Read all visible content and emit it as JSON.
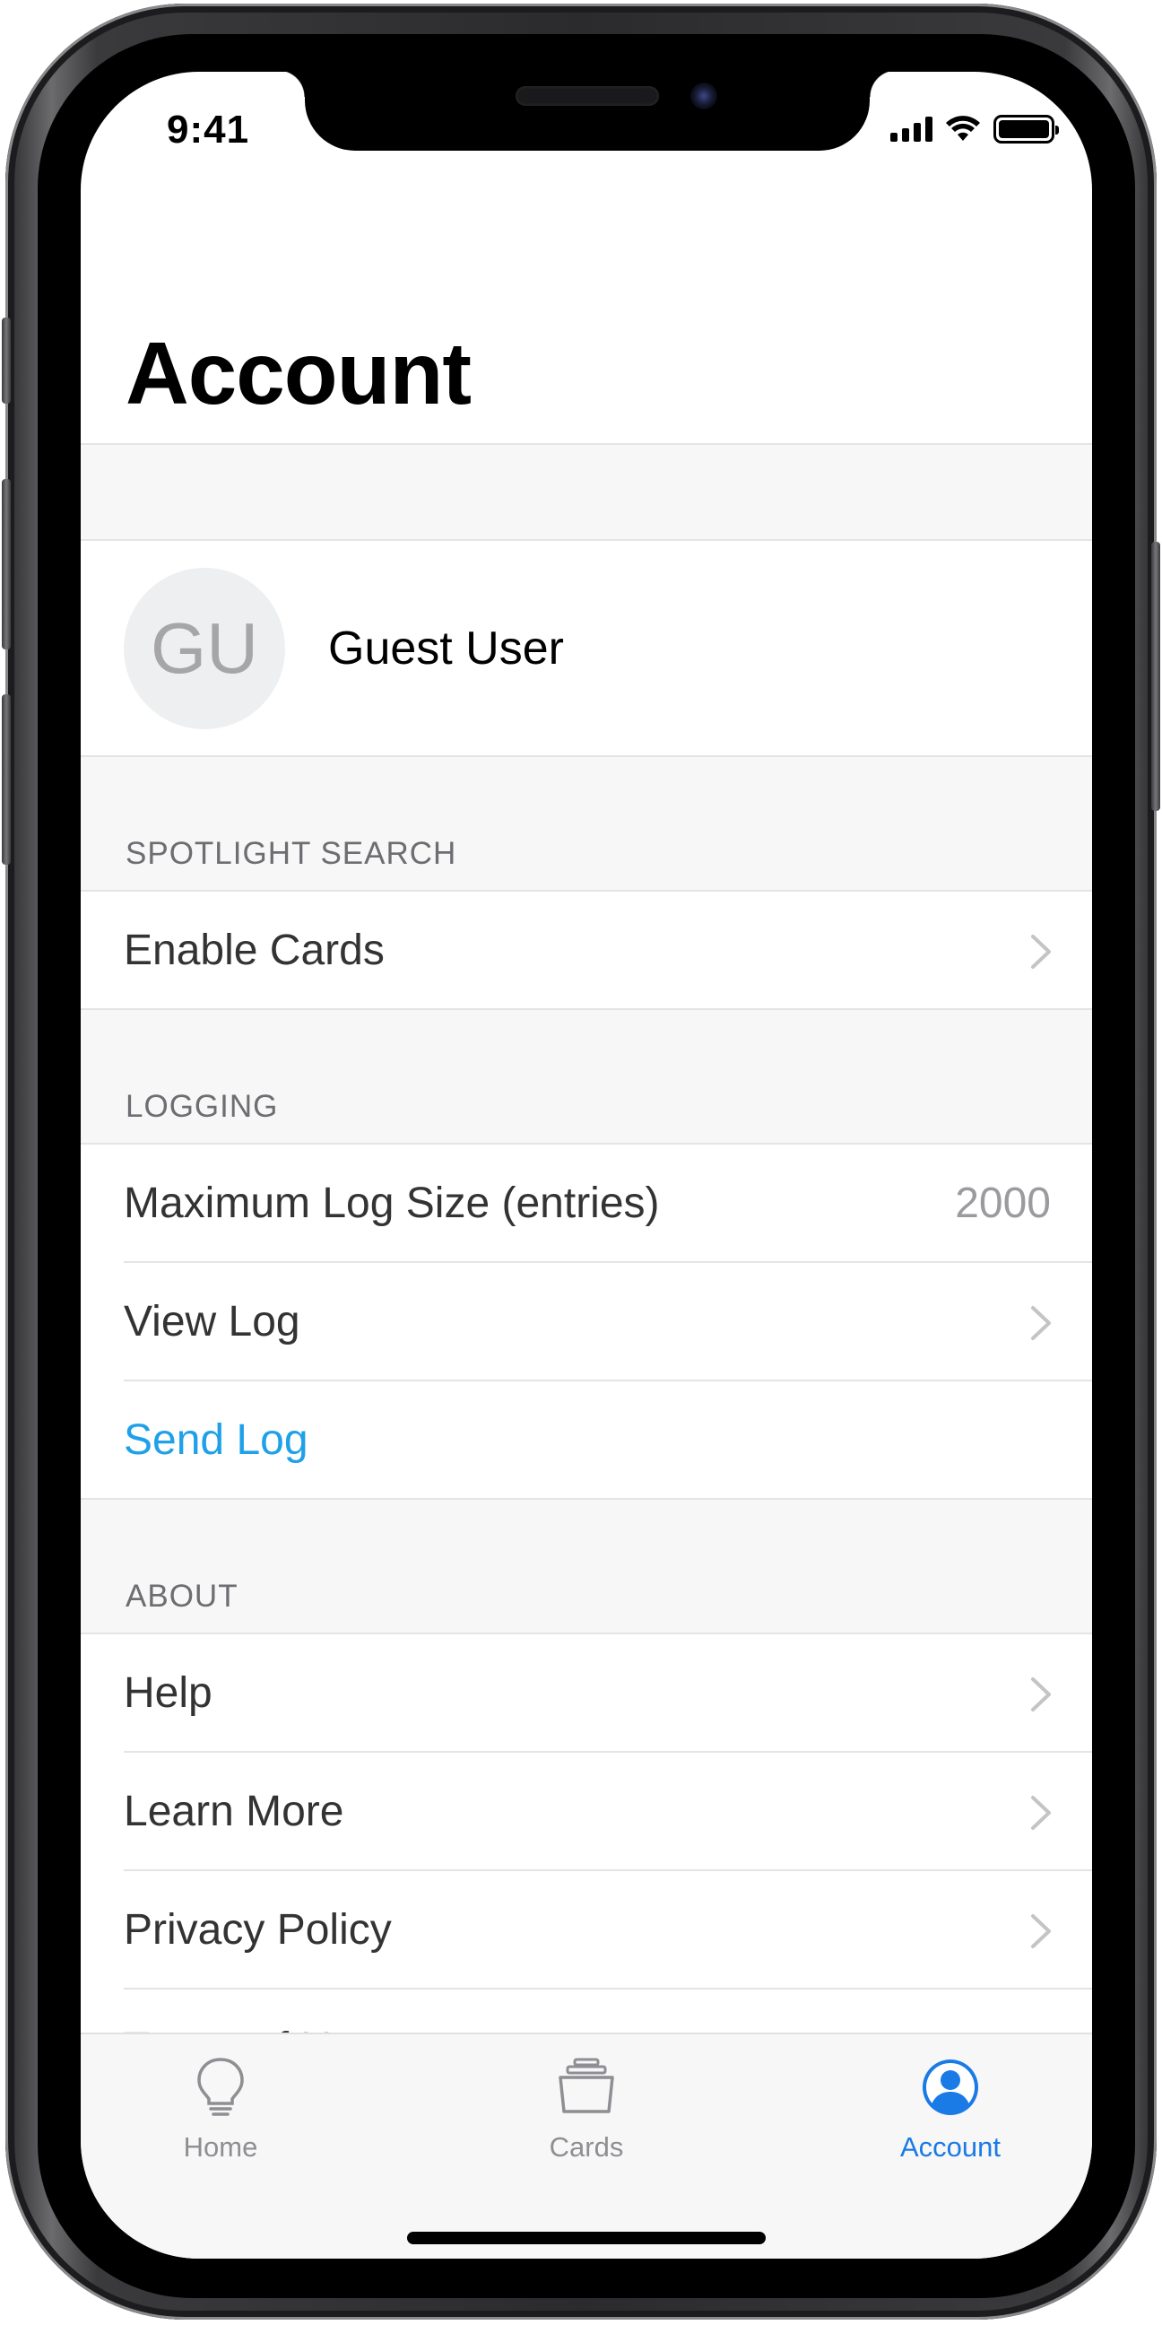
{
  "status_bar": {
    "time": "9:41"
  },
  "header": {
    "title": "Account"
  },
  "profile": {
    "initials": "GU",
    "name": "Guest User"
  },
  "sections": {
    "spotlight": {
      "title": "SPOTLIGHT SEARCH",
      "rows": [
        {
          "label": "Enable Cards",
          "icon": "chevron-right-icon"
        }
      ]
    },
    "logging": {
      "title": "LOGGING",
      "rows": [
        {
          "label": "Maximum Log Size (entries)",
          "value": "2000"
        },
        {
          "label": "View Log",
          "icon": "chevron-right-icon"
        },
        {
          "label": "Send Log",
          "color": "#1ea1e8"
        }
      ]
    },
    "about": {
      "title": "ABOUT",
      "rows": [
        {
          "label": "Help",
          "icon": "chevron-right-icon"
        },
        {
          "label": "Learn More",
          "icon": "chevron-right-icon"
        },
        {
          "label": "Privacy Policy",
          "icon": "chevron-right-icon"
        },
        {
          "label": "Terms of Use",
          "icon": "chevron-right-icon"
        }
      ]
    }
  },
  "tabbar": {
    "tabs": [
      {
        "label": "Home",
        "icon": "lightbulb-icon",
        "active": false
      },
      {
        "label": "Cards",
        "icon": "cards-stack-icon",
        "active": false
      },
      {
        "label": "Account",
        "icon": "person-circle-icon",
        "active": true
      }
    ],
    "active_color": "#1a7ae6",
    "inactive_color": "#8e8e93"
  }
}
